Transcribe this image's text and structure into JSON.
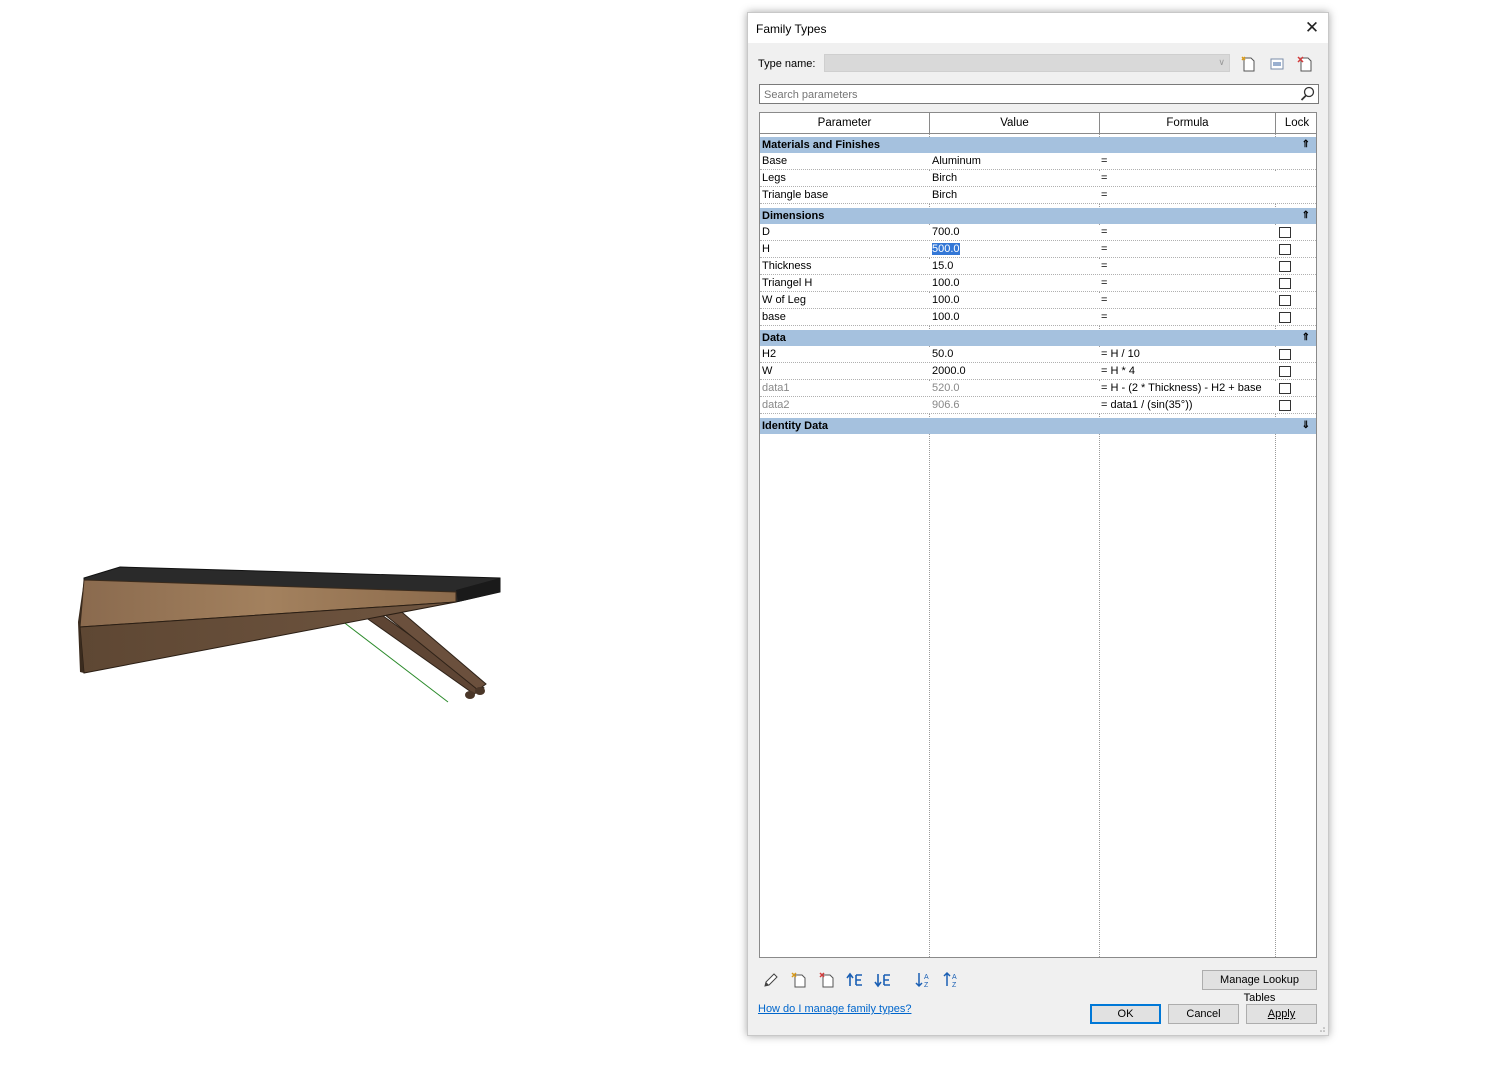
{
  "dialog": {
    "title": "Family Types",
    "type_name_label": "Type name:",
    "type_name_value": "",
    "search_placeholder": "Search parameters",
    "columns": [
      "Parameter",
      "Value",
      "Formula",
      "Lock"
    ],
    "groups": [
      {
        "name": "Materials and Finishes",
        "collapsed": false,
        "rows": [
          {
            "param": "Base",
            "value": "Aluminum",
            "formula": "=",
            "lock": null
          },
          {
            "param": "Legs",
            "value": "Birch",
            "formula": "=",
            "lock": null
          },
          {
            "param": "Triangle base",
            "value": "Birch",
            "formula": "=",
            "lock": null
          }
        ]
      },
      {
        "name": "Dimensions",
        "collapsed": false,
        "rows": [
          {
            "param": "D",
            "value": "700.0",
            "formula": "=",
            "lock": false
          },
          {
            "param": "H",
            "value": "500.0",
            "formula": "=",
            "lock": false,
            "selected": true
          },
          {
            "param": "Thickness",
            "value": "15.0",
            "formula": "=",
            "lock": false
          },
          {
            "param": "Triangel H",
            "value": "100.0",
            "formula": "=",
            "lock": false
          },
          {
            "param": "W of Leg",
            "value": "100.0",
            "formula": "=",
            "lock": false
          },
          {
            "param": "base",
            "value": "100.0",
            "formula": "=",
            "lock": false
          }
        ]
      },
      {
        "name": "Data",
        "collapsed": false,
        "rows": [
          {
            "param": "H2",
            "value": "50.0",
            "formula": "= H / 10",
            "lock": false
          },
          {
            "param": "W",
            "value": "2000.0",
            "formula": "= H * 4",
            "lock": false
          },
          {
            "param": "data1",
            "value": "520.0",
            "formula": "= H - (2 * Thickness) - H2 + base",
            "lock": false,
            "muted": true
          },
          {
            "param": "data2",
            "value": "906.6",
            "formula": "= data1 / (sin(35°))",
            "lock": false,
            "muted": true
          }
        ]
      },
      {
        "name": "Identity Data",
        "collapsed": true,
        "rows": []
      }
    ],
    "manage_lookup_label": "Manage Lookup Tables",
    "help_link": "How do I manage family types?",
    "ok_label": "OK",
    "cancel_label": "Cancel",
    "apply_label": "Apply"
  },
  "colors": {
    "group_header": "#a5c1de",
    "selection": "#3377d6",
    "link": "#0066cc",
    "default_button_border": "#0078d7"
  }
}
